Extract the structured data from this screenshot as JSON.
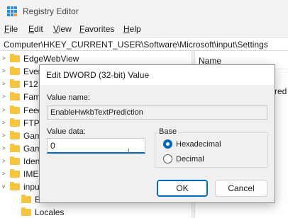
{
  "window": {
    "title": "Registry Editor",
    "app_icon": "registry-icon"
  },
  "menu": [
    {
      "key": "F",
      "rest": "ile"
    },
    {
      "key": "E",
      "rest": "dit"
    },
    {
      "key": "V",
      "rest": "iew"
    },
    {
      "key": "F",
      "rest": "avorites"
    },
    {
      "key": "H",
      "rest": "elp"
    }
  ],
  "address": "Computer\\HKEY_CURRENT_USER\\Software\\Microsoft\\input\\Settings",
  "tree": {
    "items": [
      {
        "label": "EdgeWebView",
        "expander": ">"
      },
      {
        "label": "Ever",
        "expander": ">"
      },
      {
        "label": "F12",
        "expander": ">"
      },
      {
        "label": "Fam",
        "expander": ">"
      },
      {
        "label": "Feed",
        "expander": ">"
      },
      {
        "label": "FTP",
        "expander": ">"
      },
      {
        "label": "Gam",
        "expander": ">"
      },
      {
        "label": "Gam",
        "expander": ">"
      },
      {
        "label": "Iden",
        "expander": ">"
      },
      {
        "label": "IME",
        "expander": ">"
      },
      {
        "label": "input",
        "expander": "v"
      },
      {
        "label": "E",
        "expander": ""
      },
      {
        "label": "Locales",
        "expander": ""
      }
    ]
  },
  "list": {
    "column_name": "Name",
    "partial_value": "Pred"
  },
  "dialog": {
    "title": "Edit DWORD (32-bit) Value",
    "value_name_label": "Value name:",
    "value_name": "EnableHwkbTextPrediction",
    "value_data_label": "Value data:",
    "value_data": "0",
    "base_label": "Base",
    "base_options": [
      {
        "label": "Hexadecimal",
        "checked": true
      },
      {
        "label": "Decimal",
        "checked": false
      }
    ],
    "ok_label": "OK",
    "cancel_label": "Cancel"
  },
  "colors": {
    "accent": "#0067c0",
    "folder": "#f5c542"
  }
}
